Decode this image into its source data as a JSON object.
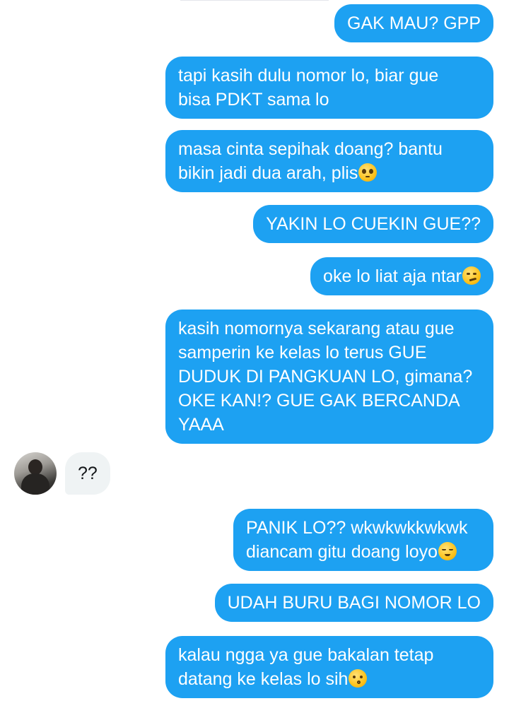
{
  "conversation": {
    "messages": [
      {
        "from": "me",
        "lines": [
          "GAK MAU? GPP"
        ]
      },
      {
        "from": "me",
        "lines": [
          "tapi kasih dulu nomor lo, biar gue",
          "bisa PDKT sama lo"
        ]
      },
      {
        "from": "me",
        "lines": [
          "masa cinta sepihak doang? bantu",
          "bikin jadi dua arah, plis"
        ],
        "emoji": "pleading-face-emoji"
      },
      {
        "from": "me",
        "lines": [
          "YAKIN LO CUEKIN GUE??"
        ]
      },
      {
        "from": "me",
        "lines": [
          "oke lo liat aja ntar"
        ],
        "emoji": "smirking-face-emoji"
      },
      {
        "from": "me",
        "lines": [
          "kasih nomornya sekarang atau gue",
          "samperin ke kelas lo terus GUE",
          "DUDUK DI PANGKUAN LO, gimana?",
          "OKE KAN!? GUE GAK BERCANDA",
          "YAAA"
        ]
      },
      {
        "from": "them",
        "lines": [
          "??"
        ]
      },
      {
        "from": "me",
        "lines": [
          "PANIK LO?? wkwkwkkwkwk",
          "diancam gitu doang loyo"
        ],
        "emoji": "relieved-face-emoji"
      },
      {
        "from": "me",
        "lines": [
          "UDAH BURU BAGI NOMOR LO"
        ]
      },
      {
        "from": "me",
        "lines": [
          "kalau ngga ya gue bakalan tetap",
          "datang ke kelas lo sih"
        ],
        "emoji": "kissing-closed-eyes-emoji"
      }
    ]
  },
  "colors": {
    "outgoing_bubble": "#1da1f2",
    "incoming_bubble": "#eff3f4",
    "outgoing_text": "#ffffff",
    "incoming_text": "#14171a"
  },
  "icons": {
    "avatar": "contact-avatar-photo"
  }
}
